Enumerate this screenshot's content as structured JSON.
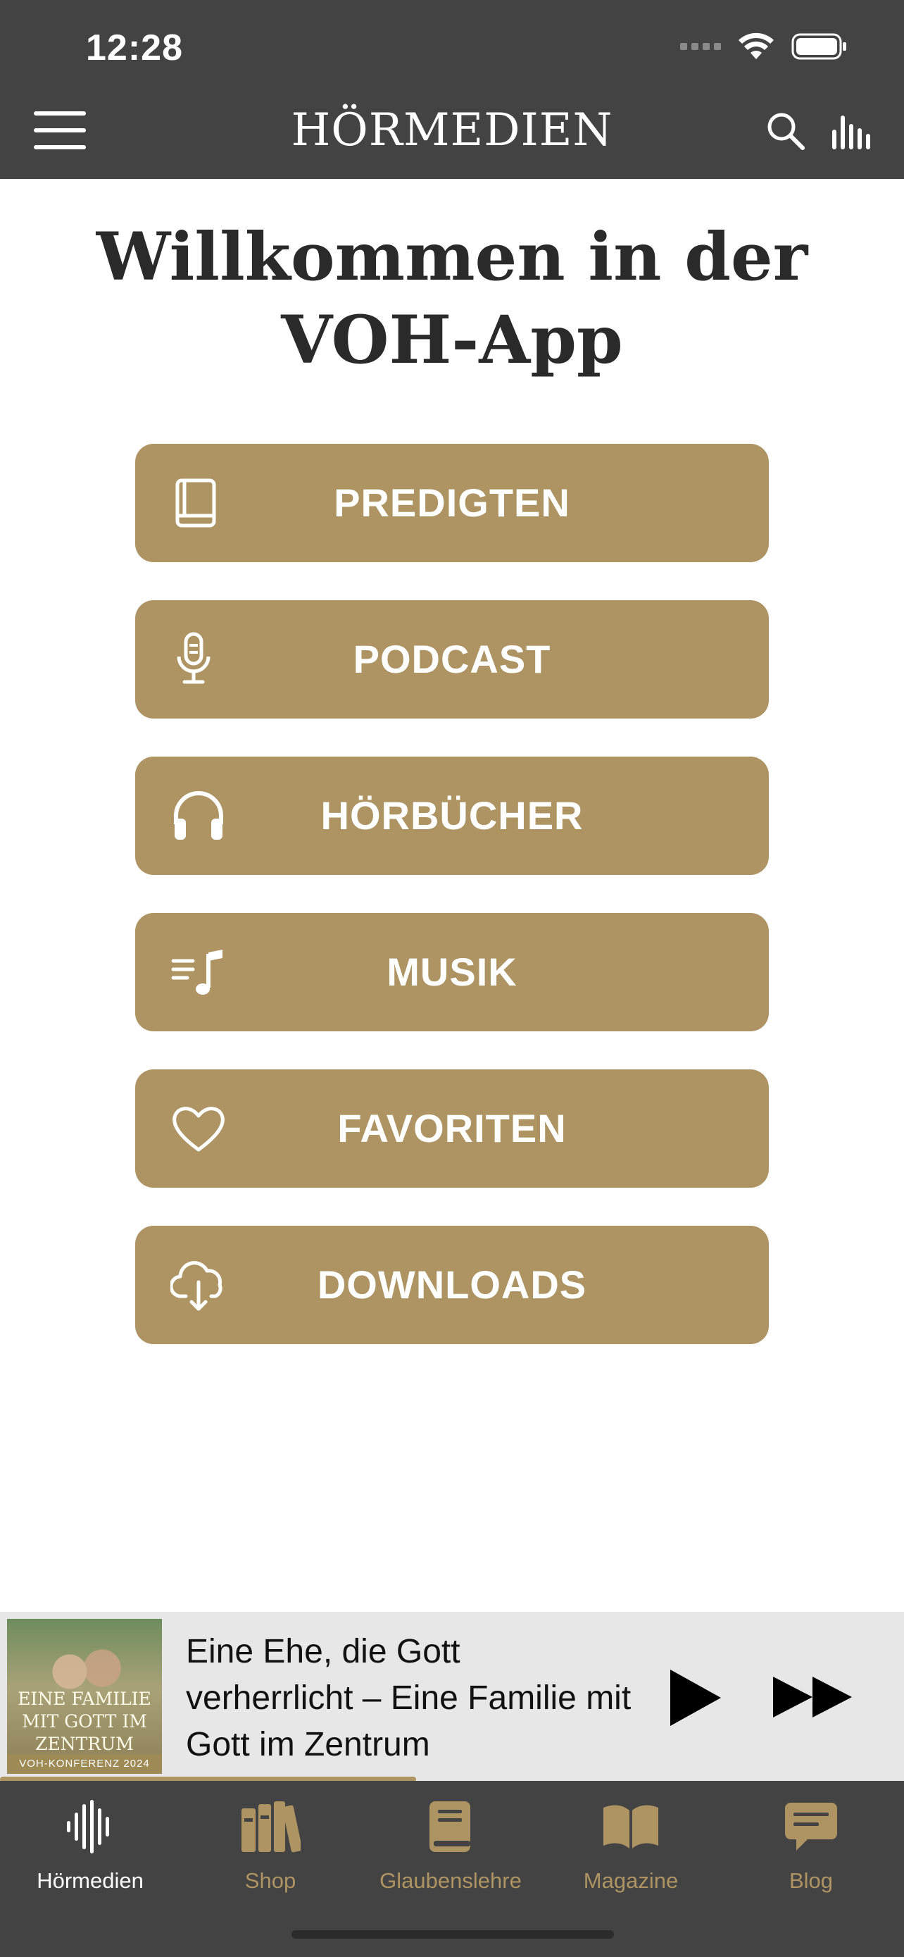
{
  "status_bar": {
    "time": "12:28"
  },
  "header": {
    "title": "HÖRMEDIEN"
  },
  "welcome": {
    "line1": "Willkommen in der",
    "line2": "VOH-App"
  },
  "menu": {
    "predigten": "PREDIGTEN",
    "podcast": "PODCAST",
    "hoerbuecher": "HÖRBÜCHER",
    "musik": "MUSIK",
    "favoriten": "FAVORITEN",
    "downloads": "DOWNLOADS"
  },
  "player": {
    "cover_title": "EINE FAMILIE MIT GOTT IM ZENTRUM",
    "cover_subtitle": "VOH-KONFERENZ 2024",
    "track_title": "Eine Ehe, die Gott verherrlicht – Eine Familie mit Gott im Zentrum",
    "progress_fraction": 0.46
  },
  "tabs": [
    {
      "label": "Hörmedien",
      "active": true
    },
    {
      "label": "Shop"
    },
    {
      "label": "Glaubenslehre"
    },
    {
      "label": "Magazine"
    },
    {
      "label": "Blog"
    }
  ],
  "colors": {
    "header_bg": "#434343",
    "accent": "#ae9462",
    "player_bg": "#e7e7e7"
  }
}
